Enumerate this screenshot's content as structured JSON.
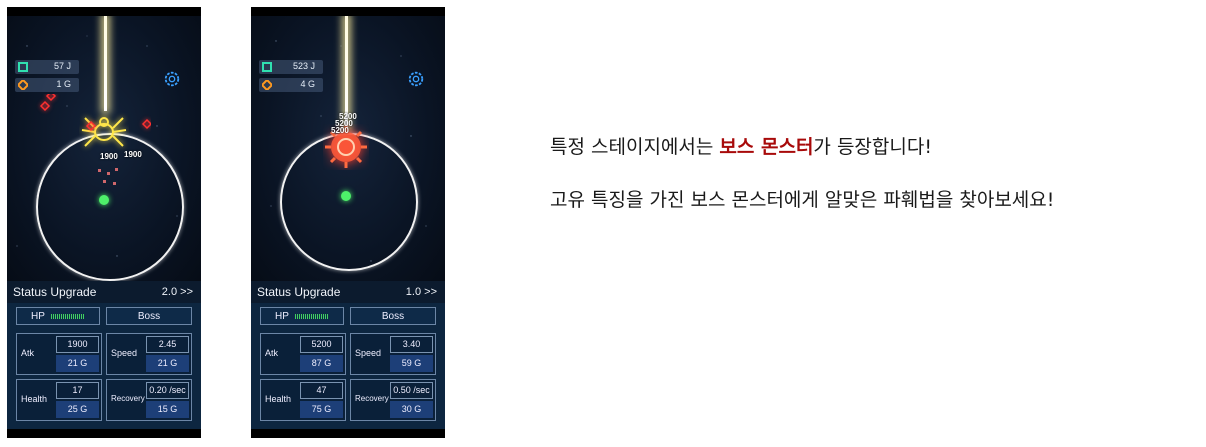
{
  "screens": [
    {
      "energy": "57 J",
      "gold": "1 G",
      "damage_numbers": [
        "1900",
        "1900"
      ],
      "status_title": "Status Upgrade",
      "game_speed": "2.0 >>",
      "hp_label": "HP",
      "hp_fill": 1.0,
      "boss_label": "Boss",
      "stats": [
        {
          "name": "Atk",
          "value": "1900",
          "cost": "21 G"
        },
        {
          "name": "Speed",
          "value": "2.45",
          "cost": "21 G"
        },
        {
          "name": "Health",
          "value": "17",
          "cost": "25 G"
        },
        {
          "name": "Recovery",
          "value": "0.20 /sec",
          "cost": "15 G"
        }
      ]
    },
    {
      "energy": "523 J",
      "gold": "4 G",
      "damage_numbers": [
        "5200",
        "5200",
        "5200"
      ],
      "status_title": "Status Upgrade",
      "game_speed": "1.0 >>",
      "hp_label": "HP",
      "hp_fill": 1.0,
      "boss_label": "Boss",
      "stats": [
        {
          "name": "Atk",
          "value": "5200",
          "cost": "87 G"
        },
        {
          "name": "Speed",
          "value": "3.40",
          "cost": "59 G"
        },
        {
          "name": "Health",
          "value": "47",
          "cost": "75 G"
        },
        {
          "name": "Recovery",
          "value": "0.50 /sec",
          "cost": "30 G"
        }
      ]
    }
  ],
  "caption": {
    "line1_before": "특정 스테이지에서는 ",
    "line1_highlight": "보스 몬스터",
    "line1_after": "가 등장합니다!",
    "line2": "고유 특징을 가진 보스 몬스터에게 알맞은 파훼법을 찾아보세요!",
    "highlight_color": "#a80a0a"
  },
  "icons": {
    "energy": "green-square-energy-icon",
    "gold": "orange-diamond-gold-icon",
    "settings": "gear-icon"
  }
}
